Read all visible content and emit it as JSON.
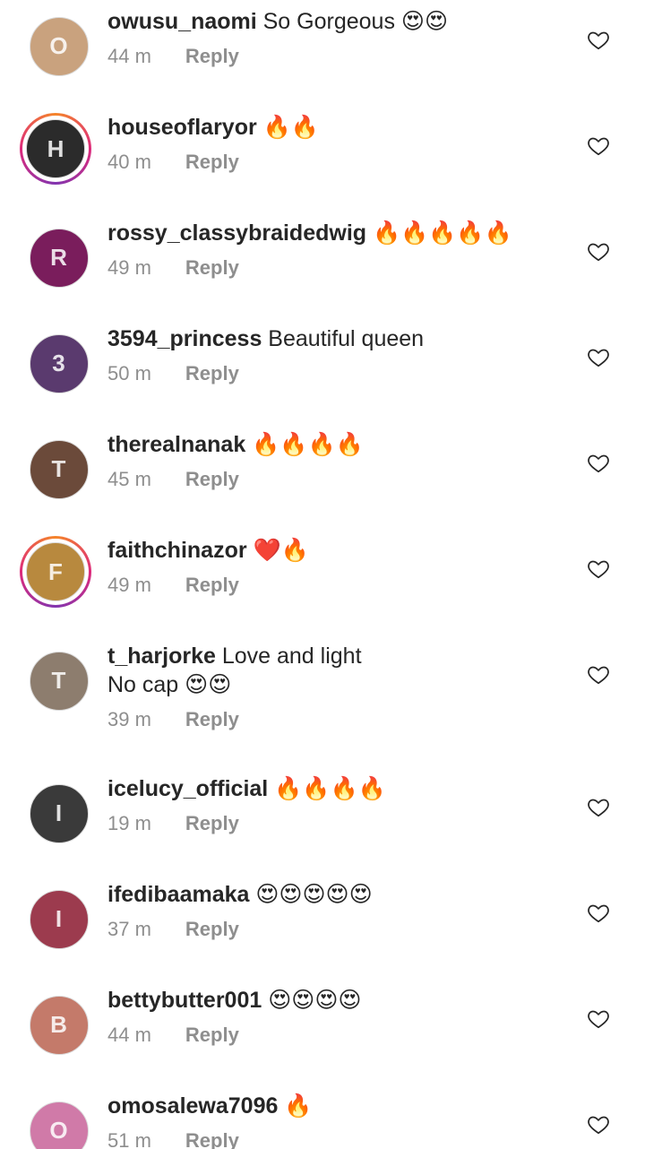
{
  "comments": [
    {
      "username": "owusu_naomi",
      "text": " So Gorgeous 😍😍",
      "time": "44 m",
      "reply": "Reply",
      "story": false,
      "avatar_color": "#c9a27e",
      "avatar_initial": "O"
    },
    {
      "username": "houseoflaryor",
      "text": " 🔥🔥",
      "time": "40 m",
      "reply": "Reply",
      "story": true,
      "avatar_color": "#2b2b2b",
      "avatar_initial": "H"
    },
    {
      "username": "rossy_classybraidedwig",
      "text": " 🔥🔥🔥🔥🔥",
      "time": "49 m",
      "reply": "Reply",
      "story": false,
      "avatar_color": "#7a1d5c",
      "avatar_initial": "R"
    },
    {
      "username": "3594_princess",
      "text": " Beautiful queen",
      "time": "50 m",
      "reply": "Reply",
      "story": false,
      "avatar_color": "#5a3a6e",
      "avatar_initial": "3"
    },
    {
      "username": "therealnanak",
      "text": " 🔥🔥🔥🔥",
      "time": "45 m",
      "reply": "Reply",
      "story": false,
      "avatar_color": "#6b4a3a",
      "avatar_initial": "T"
    },
    {
      "username": "faithchinazor",
      "text": " ❤️🔥",
      "time": "49 m",
      "reply": "Reply",
      "story": true,
      "avatar_color": "#b8893e",
      "avatar_initial": "F"
    },
    {
      "username": "t_harjorke",
      "text": " Love and light\n No cap 😍😍",
      "time": "39 m",
      "reply": "Reply",
      "story": false,
      "avatar_color": "#8d7d6e",
      "avatar_initial": "T"
    },
    {
      "username": "icelucy_official",
      "text": " 🔥🔥🔥🔥",
      "time": "19 m",
      "reply": "Reply",
      "story": false,
      "avatar_color": "#3a3a3a",
      "avatar_initial": "I"
    },
    {
      "username": "ifedibaamaka",
      "text": " 😍😍😍😍😍",
      "time": "37 m",
      "reply": "Reply",
      "story": false,
      "avatar_color": "#9c3b4e",
      "avatar_initial": "I"
    },
    {
      "username": "bettybutter001",
      "text": " 😍😍😍😍",
      "time": "44 m",
      "reply": "Reply",
      "story": false,
      "avatar_color": "#c47a6a",
      "avatar_initial": "B"
    },
    {
      "username": "omosalewa7096",
      "text": " 🔥",
      "time": "51 m",
      "reply": "Reply",
      "story": false,
      "avatar_color": "#d07aa8",
      "avatar_initial": "O"
    }
  ],
  "icons": {
    "like": "heart-outline-icon"
  },
  "colors": {
    "text": "#262626",
    "secondary": "#8e8e8e",
    "story_ring": "#dd2a7b"
  }
}
